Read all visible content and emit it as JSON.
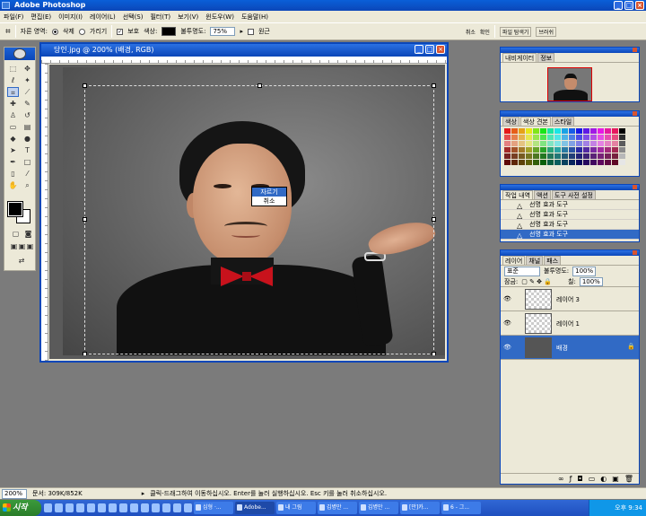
{
  "app": {
    "title": "Adobe Photoshop"
  },
  "menu": [
    "파일(F)",
    "편집(E)",
    "이미지(I)",
    "레이어(L)",
    "선택(S)",
    "필터(T)",
    "보기(V)",
    "윈도우(W)",
    "도움말(H)"
  ],
  "options": {
    "crop_area_label": "자른 영역:",
    "delete_label": "삭제",
    "hide_label": "가리기",
    "shield_label": "보호",
    "color_label": "색상:",
    "opacity_label": "불투명도:",
    "opacity_value": "75%",
    "perspective_label": "원근",
    "cancel_small": "취소",
    "confirm_small": "확인"
  },
  "document": {
    "title": "당인.jpg @ 200% (배경, RGB)",
    "context_menu": [
      "자르기",
      "취소"
    ]
  },
  "palettes": {
    "file_browser_tab": "파일 탐색기",
    "brush_tab": "브러쉬",
    "navigator_tabs": [
      "내비게이터",
      "정보"
    ],
    "color_tabs": [
      "색상",
      "색상 견본",
      "스타일"
    ],
    "history_tabs": [
      "작업 내역",
      "액션",
      "도구 사전 설정"
    ],
    "history_items": [
      "선명 효과 도구",
      "선명 효과 도구",
      "선명 효과 도구",
      "선명 효과 도구"
    ],
    "layers_tabs": [
      "레이어",
      "채널",
      "패스"
    ],
    "blend_mode": "표준",
    "opacity_label": "불투명도:",
    "opacity_value": "100%",
    "lock_label": "잠금:",
    "fill_label": "칠:",
    "fill_value": "100%",
    "layers": [
      {
        "name": "레이어 3"
      },
      {
        "name": "레이어 1"
      },
      {
        "name": "배경"
      }
    ]
  },
  "status": {
    "zoom": "200%",
    "doc": "문서: 309K/852K",
    "hint": "클릭-드래그하여 이동하십시오. Enter를 눌러 실행하십시오. Esc 키를 눌러 취소하십시오."
  },
  "taskbar": {
    "start": "시작",
    "tasks": [
      "심형 ·...",
      "Adobe...",
      "내 그림",
      "김병만 ...",
      "김병만 ...",
      "[만]카...",
      "6 - 그..."
    ],
    "clock": "오후 9:34"
  },
  "colors": {
    "xp_blue": "#0b46b8",
    "selection": "#316ac5",
    "bowtie_red": "#c8121c"
  }
}
